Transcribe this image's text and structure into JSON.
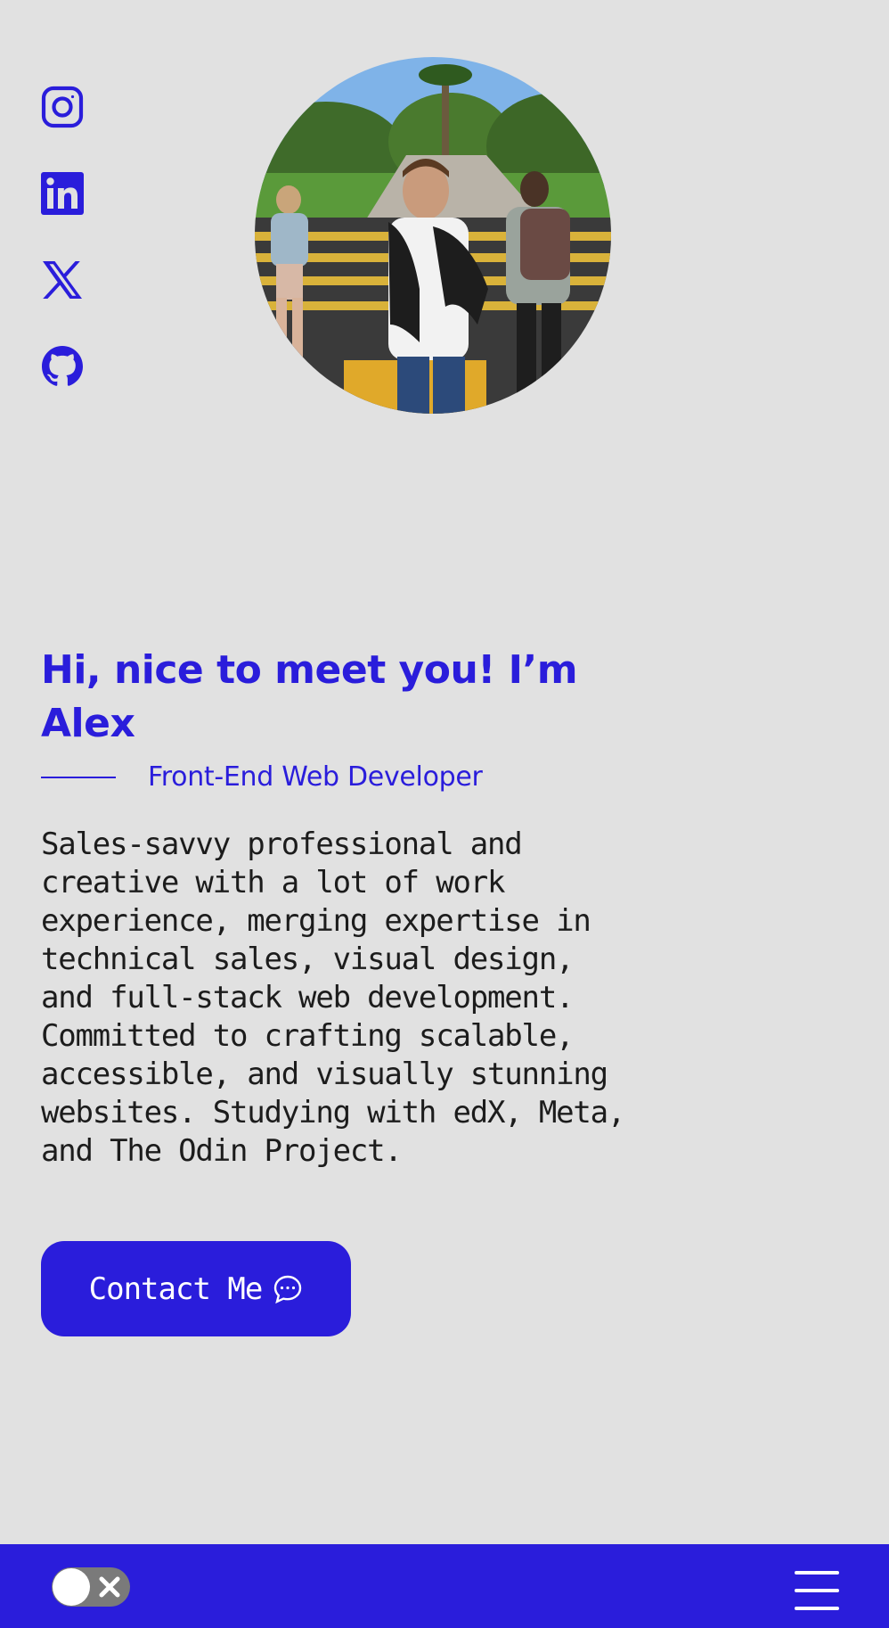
{
  "social": {
    "items": [
      {
        "icon": "instagram-icon"
      },
      {
        "icon": "linkedin-icon"
      },
      {
        "icon": "x-twitter-icon"
      },
      {
        "icon": "github-icon"
      }
    ]
  },
  "hero": {
    "greeting": "Hi, nice to meet you! I’m Alex",
    "role": "Front-End Web Developer",
    "bio": "Sales-savvy professional and creative with a lot of work experience, merging expertise in technical sales, visual design, and full-stack web development. Committed to crafting scalable, accessible, and visually stunning websites. Studying with edX, Meta, and The Odin Project.",
    "contact_label": "Contact Me",
    "contact_icon": "chat-bubble-icon"
  },
  "footer": {
    "theme_toggle_icon": "close-icon",
    "menu_icon": "hamburger-menu-icon"
  },
  "colors": {
    "accent": "#2a1ddb",
    "background": "#e1e1e1",
    "text": "#1c1c1c"
  }
}
